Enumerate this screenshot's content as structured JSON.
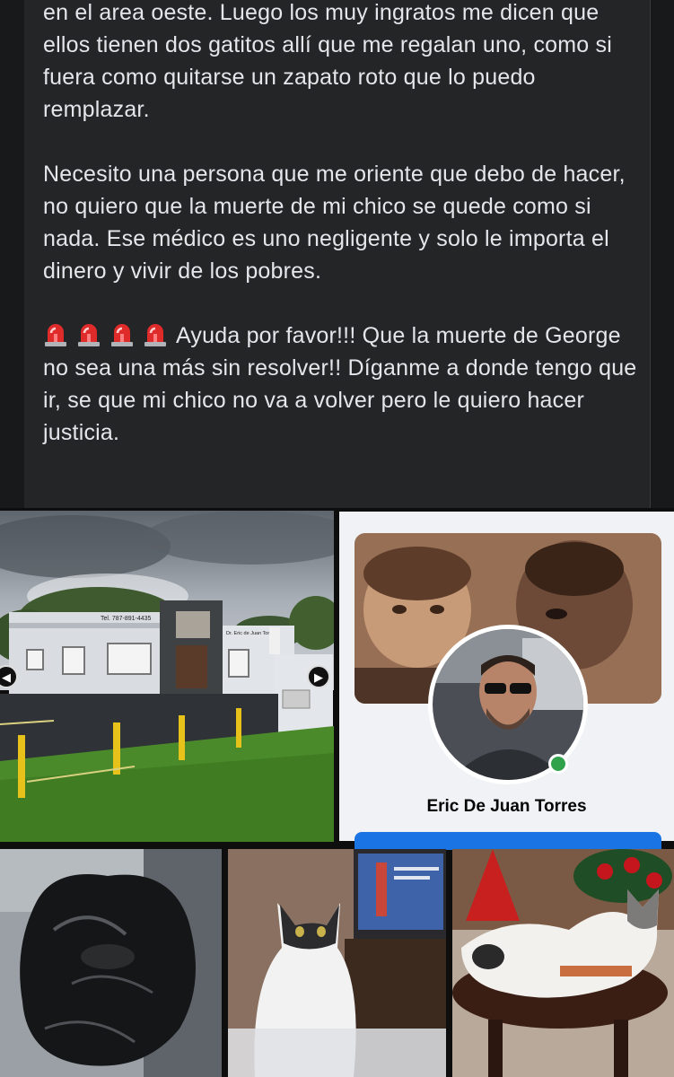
{
  "post": {
    "paragraphs": [
      "en el area oeste. Luego los muy ingratos me dicen que ellos tienen dos gatitos allí que me regalan uno, como si fuera como quitarse un zapato roto que lo puedo remplazar.",
      "Necesito una persona que me oriente que debo de hacer, no quiero que la muerte de mi chico se quede como si nada. Ese médico es uno negligente y solo le importa el dinero y vivir de los pobres.",
      "Ayuda por favor!!! Que la muerte de George no sea una más sin resolver!! Díganme a donde tengo que ir, se que mi chico no va a volver pero le quiero hacer justicia."
    ],
    "emoji": [
      "police-car-light-icon",
      "police-car-light-icon",
      "police-car-light-icon",
      "police-car-light-icon"
    ]
  },
  "photos": {
    "clinic_sign": "Tel. 787-891-4435",
    "clinic_name_sign": "Dr. Eric de Juan Torres",
    "profile_name": "Eric De Juan Torres"
  },
  "colors": {
    "background": "#18191a",
    "card": "#242526",
    "text": "#e4e6eb",
    "online": "#31a24c",
    "button": "#1b74e4"
  }
}
